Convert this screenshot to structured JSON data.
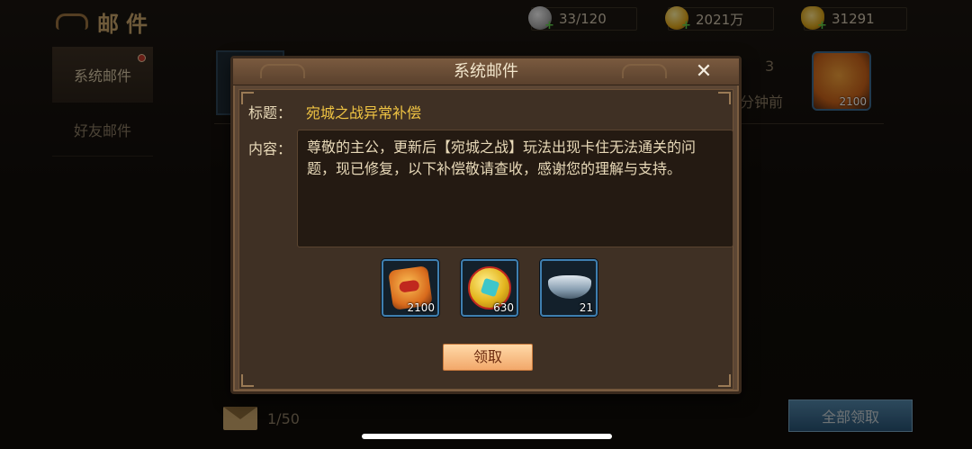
{
  "page": {
    "title": "邮件"
  },
  "resources": {
    "stamina": {
      "value": "33/120",
      "icon": "silver-orb-icon"
    },
    "gold": {
      "value": "2021万",
      "icon": "gold-coin-icon"
    },
    "ingot": {
      "value": "31291",
      "icon": "gold-ingot-icon"
    },
    "plus": "+"
  },
  "sidebar": {
    "items": [
      {
        "label": "系统邮件",
        "active": true,
        "has_dot": true
      },
      {
        "label": "好友邮件",
        "active": false,
        "has_dot": false
      }
    ]
  },
  "mail_list": {
    "row": {
      "count": "3",
      "time": "分钟前",
      "reward_count": "2100"
    }
  },
  "footer": {
    "count": "1/50",
    "claim_all_label": "全部领取"
  },
  "modal": {
    "title": "系统邮件",
    "close": "✕",
    "subject_label": "标题：",
    "subject": "宛城之战异常补偿",
    "content_label": "内容：",
    "content": "尊敬的主公，更新后【宛城之战】玩法出现卡住无法通关的问题，现已修复，以下补偿敬请查收，感谢您的理解与支持。",
    "rewards": [
      {
        "icon": "red-token-icon",
        "count": "2100"
      },
      {
        "icon": "gold-coin-icon",
        "count": "630"
      },
      {
        "icon": "silver-bowl-icon",
        "count": "21"
      }
    ],
    "claim_label": "领取"
  },
  "colors": {
    "subject": "#f0c443",
    "claim_button": "#f2a86a",
    "claim_all_button": "#2d5f86",
    "modal_bg": "#5c4634"
  }
}
